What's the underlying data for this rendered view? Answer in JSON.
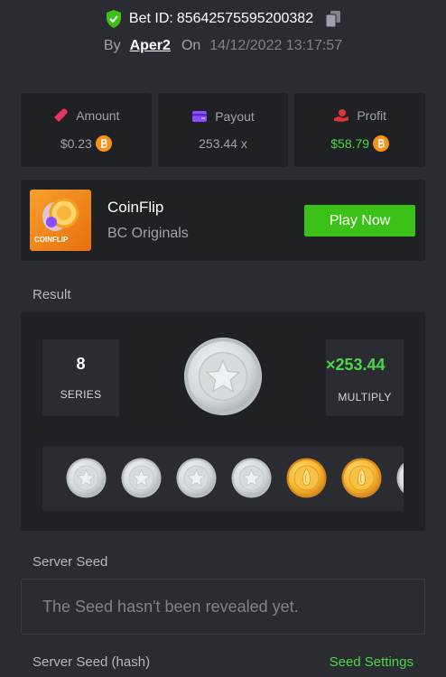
{
  "bet": {
    "label": "Bet ID:",
    "id": "85642575595200382",
    "by_label": "By",
    "user": "Aper2",
    "on_label": "On",
    "datetime": "14/12/2022 13:17:57"
  },
  "stats": {
    "amount": {
      "label": "Amount",
      "value": "$0.23",
      "icon": "amount-icon"
    },
    "payout": {
      "label": "Payout",
      "value": "253.44 x",
      "icon": "payout-icon"
    },
    "profit": {
      "label": "Profit",
      "value": "$58.79",
      "icon": "profit-icon"
    }
  },
  "game": {
    "name": "CoinFlip",
    "provider": "BC Originals",
    "thumb_label": "COINFLIP",
    "play_label": "Play Now"
  },
  "result": {
    "label": "Result",
    "series_value": "8",
    "series_label": "SERIES",
    "multiplier": "×253.44",
    "multiplier_label": "MULTIPLY",
    "coins": [
      "silver",
      "silver",
      "silver",
      "silver",
      "gold",
      "gold",
      "silver"
    ]
  },
  "seed": {
    "server_label": "Server Seed",
    "server_placeholder": "The Seed hasn't been revealed yet.",
    "hash_label": "Server Seed (hash)",
    "settings_label": "Seed Settings"
  },
  "colors": {
    "background": "#2a2c31",
    "card": "#1f2125",
    "accent_green": "#4ed64a",
    "button_green": "#3bc117",
    "bitcoin_orange": "#f7931a"
  }
}
